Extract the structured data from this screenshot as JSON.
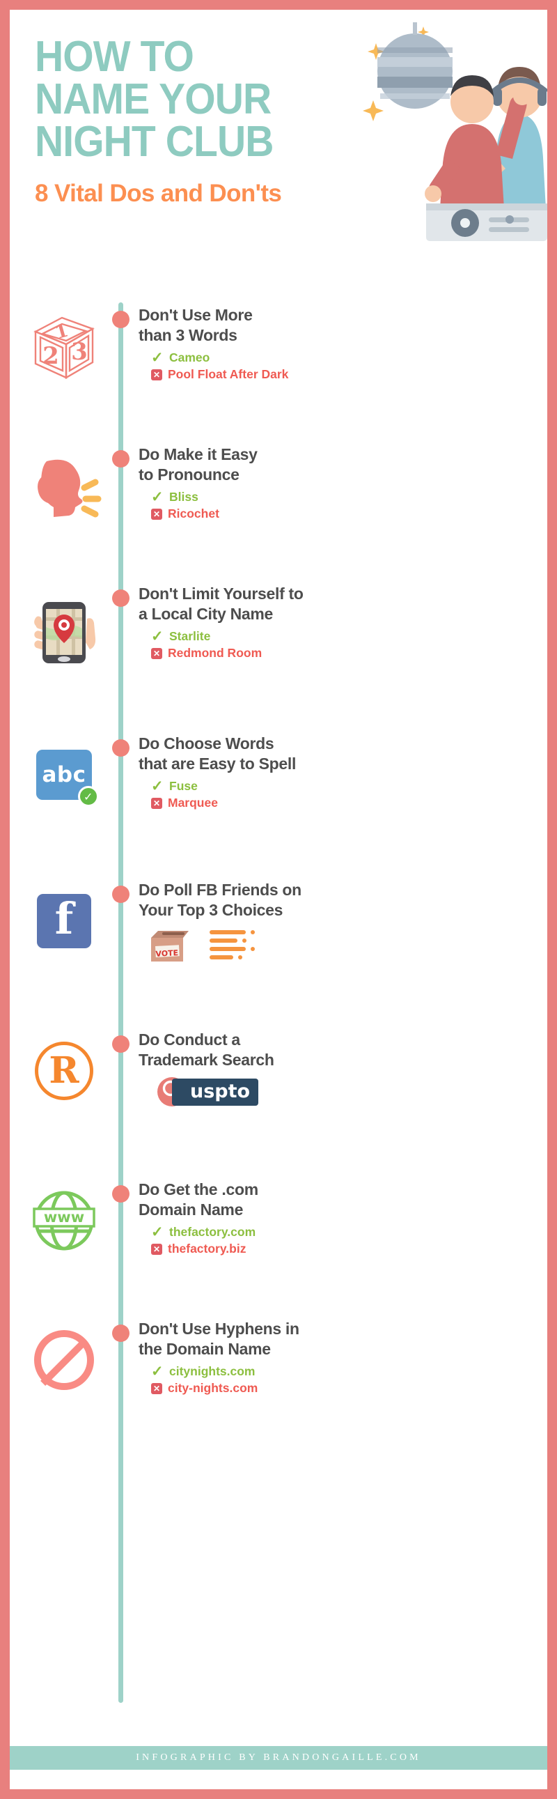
{
  "colors": {
    "border": "#e8807e",
    "title": "#8ecbc0",
    "subtitle": "#fc8f51",
    "spine": "#9ed2c8",
    "dot": "#ef8279",
    "heading": "#4d4d4d",
    "good": "#8cbf3f",
    "bad": "#ef5a52",
    "footer_bar": "#9ed2c8"
  },
  "header": {
    "title_lines": [
      "HOW TO",
      "NAME YOUR",
      "NIGHT CLUB"
    ],
    "subtitle": "8 Vital Dos and Don'ts",
    "illustration": "dj-booth-disco-ball"
  },
  "items": [
    {
      "icon": "abc-blocks-123-icon",
      "title_lines": [
        "Don't Use More",
        "than 3 Words"
      ],
      "examples": [
        {
          "mark": "check",
          "text": "Cameo"
        },
        {
          "mark": "cross",
          "text": "Pool Float After Dark"
        }
      ]
    },
    {
      "icon": "speaking-head-icon",
      "title_lines": [
        "Do Make it Easy",
        "to Pronounce"
      ],
      "examples": [
        {
          "mark": "check",
          "text": "Bliss"
        },
        {
          "mark": "cross",
          "text": "Ricochet"
        }
      ]
    },
    {
      "icon": "hand-holding-phone-map-pin-icon",
      "title_lines": [
        "Don't Limit Yourself to",
        "a Local City Name"
      ],
      "examples": [
        {
          "mark": "check",
          "text": "Starlite"
        },
        {
          "mark": "cross",
          "text": "Redmond Room"
        }
      ]
    },
    {
      "icon": "abc-spelling-icon",
      "icon_label": "abc",
      "title_lines": [
        "Do Choose Words",
        "that are Easy to Spell"
      ],
      "examples": [
        {
          "mark": "check",
          "text": "Fuse"
        },
        {
          "mark": "cross",
          "text": "Marquee"
        }
      ]
    },
    {
      "icon": "facebook-icon",
      "icon_label": "f",
      "title_lines": [
        "Do Poll FB Friends on",
        "Your Top 3 Choices"
      ],
      "examples": [],
      "extra": {
        "vote_box_label": "VOTE",
        "list_icon": "poll-list-icon"
      }
    },
    {
      "icon": "registered-trademark-icon",
      "icon_label": "R",
      "title_lines": [
        "Do Conduct a",
        "Trademark Search"
      ],
      "examples": [],
      "extra": {
        "logo_text": "uspto",
        "logo_mark": "uspto-magnifier-icon"
      }
    },
    {
      "icon": "www-globe-icon",
      "icon_label": "www",
      "title_lines": [
        "Do Get the .com",
        "Domain Name"
      ],
      "examples": [
        {
          "mark": "check",
          "text": "thefactory.com"
        },
        {
          "mark": "cross",
          "text": "thefactory.biz"
        }
      ]
    },
    {
      "icon": "prohibited-sign-icon",
      "title_lines": [
        "Don't Use Hyphens in",
        "the Domain Name"
      ],
      "examples": [
        {
          "mark": "check",
          "text": "citynights.com"
        },
        {
          "mark": "cross",
          "text": "city-nights.com"
        }
      ]
    }
  ],
  "footer": {
    "text": "Infographic by BrandonGaille.com"
  }
}
